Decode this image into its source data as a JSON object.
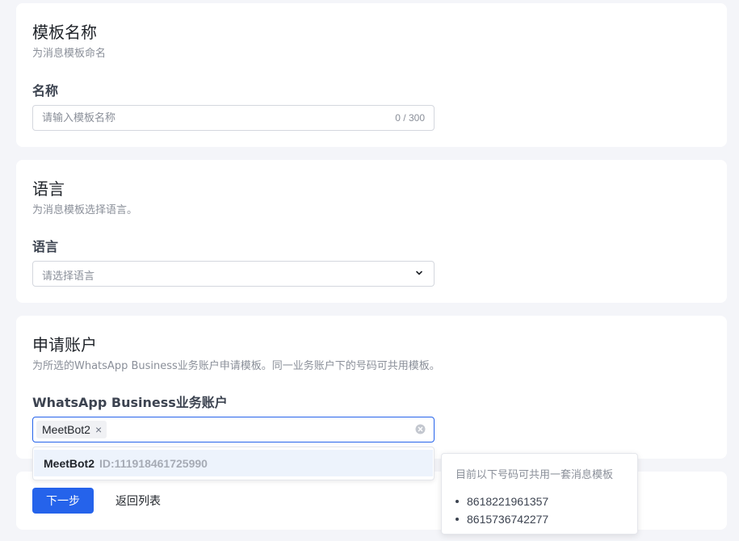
{
  "template_name": {
    "title": "模板名称",
    "subtitle": "为消息模板命名",
    "field_label": "名称",
    "placeholder": "请输入模板名称",
    "value": "",
    "counter": "0 / 300"
  },
  "language": {
    "title": "语言",
    "subtitle": "为消息模板选择语言。",
    "field_label": "语言",
    "placeholder": "请选择语言"
  },
  "account": {
    "title": "申请账户",
    "subtitle": "为所选的WhatsApp Business业务账户申请模板。同一业务账户下的号码可共用模板。",
    "field_label": "WhatsApp Business业务账户",
    "selected_tag": "MeetBot2",
    "dropdown_option": {
      "name": "MeetBot2",
      "id": "ID:111918461725990"
    }
  },
  "popover": {
    "title": "目前以下号码可共用一套消息模板",
    "numbers": [
      "8618221961357",
      "8615736742277"
    ]
  },
  "actions": {
    "next_label": "下一步",
    "back_label": "返回列表"
  },
  "colors": {
    "primary": "#2563eb",
    "background": "#f4f5f9",
    "option_highlight": "#edf3fc"
  }
}
